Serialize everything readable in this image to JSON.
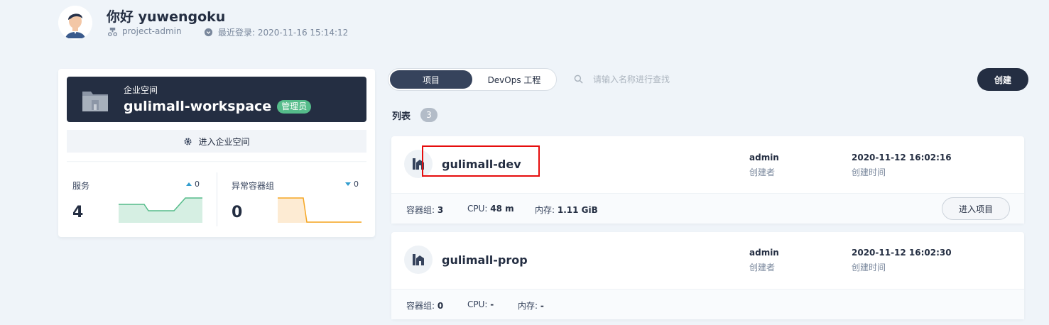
{
  "user": {
    "greeting": "你好 yuwengoku",
    "role": "project-admin",
    "last_login": "最近登录: 2020-11-16 15:14:12"
  },
  "workspace": {
    "label": "企业空间",
    "name": "gulimall-workspace",
    "badge": "管理员",
    "enter_label": "进入企业空间",
    "stats": [
      {
        "label": "服务",
        "value": "4",
        "trend": "0",
        "trend_dir": "up",
        "color": "#55bc8a"
      },
      {
        "label": "异常容器组",
        "value": "0",
        "trend": "0",
        "trend_dir": "down",
        "color": "#f5a623"
      }
    ]
  },
  "tabs": [
    {
      "label": "项目",
      "active": true
    },
    {
      "label": "DevOps 工程",
      "active": false
    }
  ],
  "search": {
    "placeholder": "请输入名称进行查找"
  },
  "create_label": "创建",
  "list": {
    "title": "列表",
    "count": "3"
  },
  "projects": [
    {
      "name": "gulimall-dev",
      "creator": "admin",
      "creator_label": "创建者",
      "created": "2020-11-12 16:02:16",
      "created_label": "创建时间",
      "pods_label": "容器组:",
      "pods": "3",
      "cpu_label": "CPU:",
      "cpu": "48 m",
      "mem_label": "内存:",
      "mem": "1.11 GiB",
      "enter_label": "进入项目"
    },
    {
      "name": "gulimall-prop",
      "creator": "admin",
      "creator_label": "创建者",
      "created": "2020-11-12 16:02:30",
      "created_label": "创建时间",
      "pods_label": "容器组:",
      "pods": "0",
      "cpu_label": "CPU:",
      "cpu": "-",
      "mem_label": "内存:",
      "mem": "-"
    }
  ],
  "colors": {
    "dark": "#242e42",
    "accent_green": "#55bc8a",
    "highlight_red": "#e60d0d"
  }
}
